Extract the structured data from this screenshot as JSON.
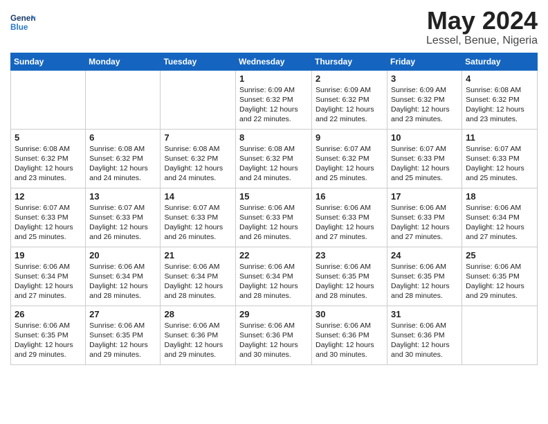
{
  "logo": {
    "text_general": "General",
    "text_blue": "Blue"
  },
  "title": "May 2024",
  "subtitle": "Lessel, Benue, Nigeria",
  "headers": [
    "Sunday",
    "Monday",
    "Tuesday",
    "Wednesday",
    "Thursday",
    "Friday",
    "Saturday"
  ],
  "weeks": [
    [
      {
        "day": "",
        "info": ""
      },
      {
        "day": "",
        "info": ""
      },
      {
        "day": "",
        "info": ""
      },
      {
        "day": "1",
        "info": "Sunrise: 6:09 AM\nSunset: 6:32 PM\nDaylight: 12 hours\nand 22 minutes."
      },
      {
        "day": "2",
        "info": "Sunrise: 6:09 AM\nSunset: 6:32 PM\nDaylight: 12 hours\nand 22 minutes."
      },
      {
        "day": "3",
        "info": "Sunrise: 6:09 AM\nSunset: 6:32 PM\nDaylight: 12 hours\nand 23 minutes."
      },
      {
        "day": "4",
        "info": "Sunrise: 6:08 AM\nSunset: 6:32 PM\nDaylight: 12 hours\nand 23 minutes."
      }
    ],
    [
      {
        "day": "5",
        "info": "Sunrise: 6:08 AM\nSunset: 6:32 PM\nDaylight: 12 hours\nand 23 minutes."
      },
      {
        "day": "6",
        "info": "Sunrise: 6:08 AM\nSunset: 6:32 PM\nDaylight: 12 hours\nand 24 minutes."
      },
      {
        "day": "7",
        "info": "Sunrise: 6:08 AM\nSunset: 6:32 PM\nDaylight: 12 hours\nand 24 minutes."
      },
      {
        "day": "8",
        "info": "Sunrise: 6:08 AM\nSunset: 6:32 PM\nDaylight: 12 hours\nand 24 minutes."
      },
      {
        "day": "9",
        "info": "Sunrise: 6:07 AM\nSunset: 6:32 PM\nDaylight: 12 hours\nand 25 minutes."
      },
      {
        "day": "10",
        "info": "Sunrise: 6:07 AM\nSunset: 6:33 PM\nDaylight: 12 hours\nand 25 minutes."
      },
      {
        "day": "11",
        "info": "Sunrise: 6:07 AM\nSunset: 6:33 PM\nDaylight: 12 hours\nand 25 minutes."
      }
    ],
    [
      {
        "day": "12",
        "info": "Sunrise: 6:07 AM\nSunset: 6:33 PM\nDaylight: 12 hours\nand 25 minutes."
      },
      {
        "day": "13",
        "info": "Sunrise: 6:07 AM\nSunset: 6:33 PM\nDaylight: 12 hours\nand 26 minutes."
      },
      {
        "day": "14",
        "info": "Sunrise: 6:07 AM\nSunset: 6:33 PM\nDaylight: 12 hours\nand 26 minutes."
      },
      {
        "day": "15",
        "info": "Sunrise: 6:06 AM\nSunset: 6:33 PM\nDaylight: 12 hours\nand 26 minutes."
      },
      {
        "day": "16",
        "info": "Sunrise: 6:06 AM\nSunset: 6:33 PM\nDaylight: 12 hours\nand 27 minutes."
      },
      {
        "day": "17",
        "info": "Sunrise: 6:06 AM\nSunset: 6:33 PM\nDaylight: 12 hours\nand 27 minutes."
      },
      {
        "day": "18",
        "info": "Sunrise: 6:06 AM\nSunset: 6:34 PM\nDaylight: 12 hours\nand 27 minutes."
      }
    ],
    [
      {
        "day": "19",
        "info": "Sunrise: 6:06 AM\nSunset: 6:34 PM\nDaylight: 12 hours\nand 27 minutes."
      },
      {
        "day": "20",
        "info": "Sunrise: 6:06 AM\nSunset: 6:34 PM\nDaylight: 12 hours\nand 28 minutes."
      },
      {
        "day": "21",
        "info": "Sunrise: 6:06 AM\nSunset: 6:34 PM\nDaylight: 12 hours\nand 28 minutes."
      },
      {
        "day": "22",
        "info": "Sunrise: 6:06 AM\nSunset: 6:34 PM\nDaylight: 12 hours\nand 28 minutes."
      },
      {
        "day": "23",
        "info": "Sunrise: 6:06 AM\nSunset: 6:35 PM\nDaylight: 12 hours\nand 28 minutes."
      },
      {
        "day": "24",
        "info": "Sunrise: 6:06 AM\nSunset: 6:35 PM\nDaylight: 12 hours\nand 28 minutes."
      },
      {
        "day": "25",
        "info": "Sunrise: 6:06 AM\nSunset: 6:35 PM\nDaylight: 12 hours\nand 29 minutes."
      }
    ],
    [
      {
        "day": "26",
        "info": "Sunrise: 6:06 AM\nSunset: 6:35 PM\nDaylight: 12 hours\nand 29 minutes."
      },
      {
        "day": "27",
        "info": "Sunrise: 6:06 AM\nSunset: 6:35 PM\nDaylight: 12 hours\nand 29 minutes."
      },
      {
        "day": "28",
        "info": "Sunrise: 6:06 AM\nSunset: 6:36 PM\nDaylight: 12 hours\nand 29 minutes."
      },
      {
        "day": "29",
        "info": "Sunrise: 6:06 AM\nSunset: 6:36 PM\nDaylight: 12 hours\nand 30 minutes."
      },
      {
        "day": "30",
        "info": "Sunrise: 6:06 AM\nSunset: 6:36 PM\nDaylight: 12 hours\nand 30 minutes."
      },
      {
        "day": "31",
        "info": "Sunrise: 6:06 AM\nSunset: 6:36 PM\nDaylight: 12 hours\nand 30 minutes."
      },
      {
        "day": "",
        "info": ""
      }
    ]
  ]
}
